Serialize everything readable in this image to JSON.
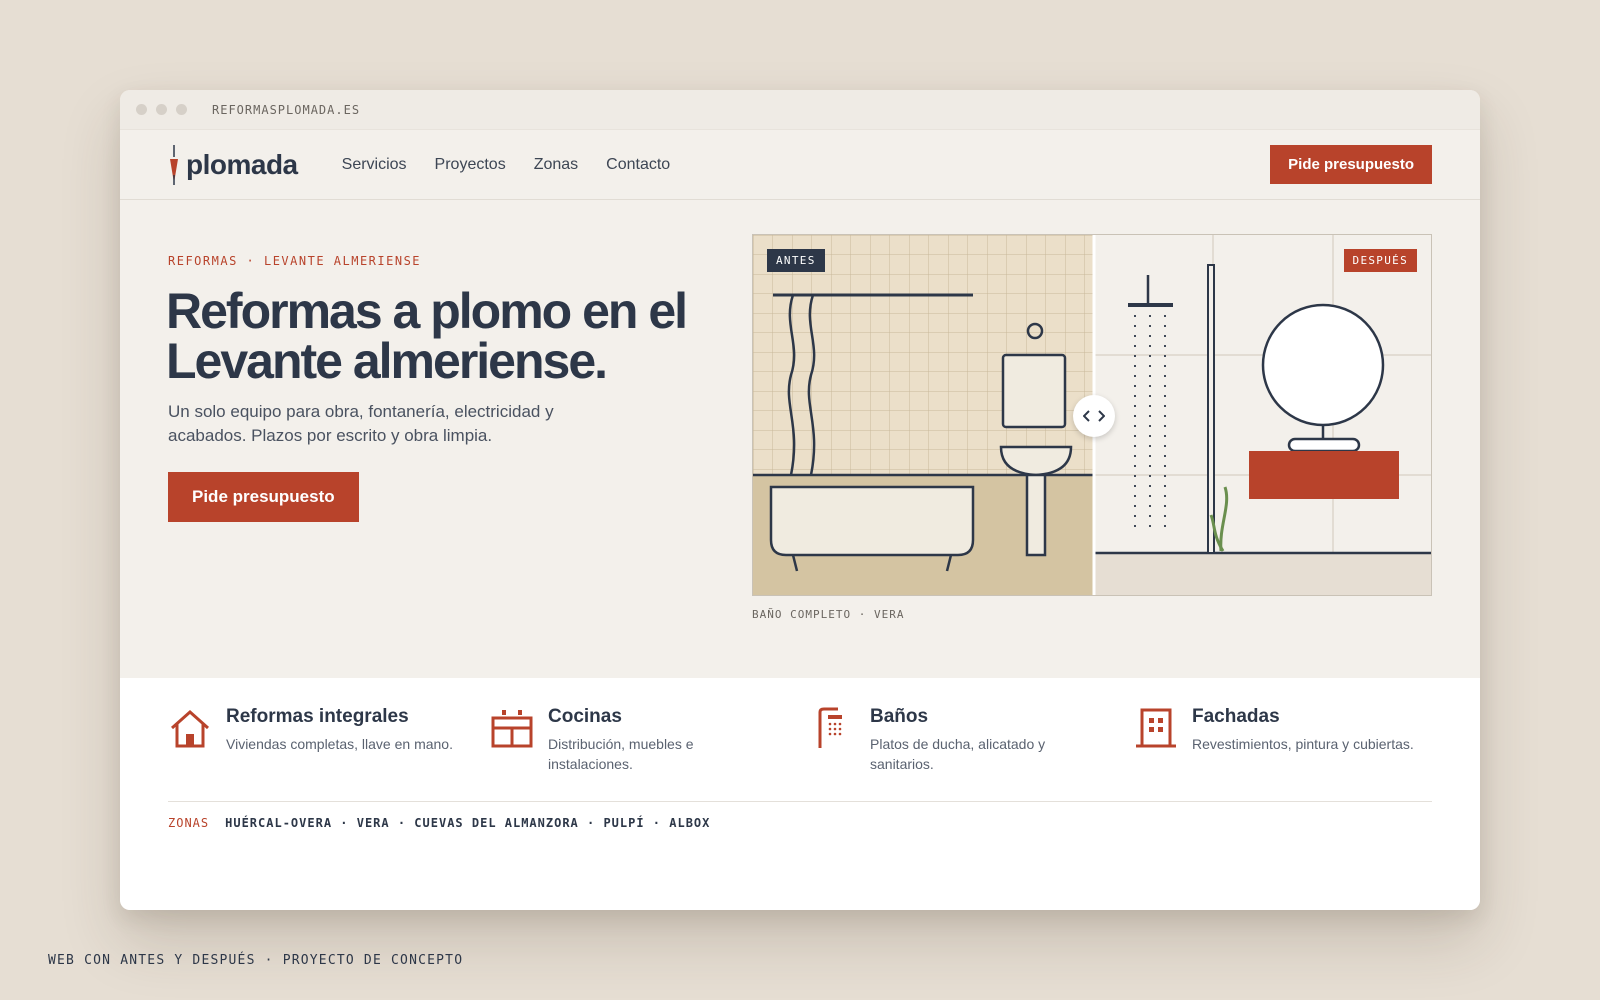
{
  "browser": {
    "url": "REFORMASPLOMADA.ES"
  },
  "nav": {
    "logo": "plomada",
    "links": [
      "Servicios",
      "Proyectos",
      "Zonas",
      "Contacto"
    ],
    "cta": "Pide presupuesto"
  },
  "hero": {
    "eyebrow": "REFORMAS · LEVANTE ALMERIENSE",
    "headline": "Reformas a plomo en el Levante almeriense.",
    "lead": "Un solo equipo para obra, fontanería, electricidad y acabados. Plazos por escrito y obra limpia.",
    "cta": "Pide presupuesto"
  },
  "comparison": {
    "before_label": "ANTES",
    "after_label": "DESPUÉS",
    "caption": "BAÑO COMPLETO · VERA",
    "handle_icon": "chevron-left-right-icon"
  },
  "services": [
    {
      "icon": "house-icon",
      "title": "Reformas integrales",
      "desc": "Viviendas completas, llave en mano."
    },
    {
      "icon": "kitchen-icon",
      "title": "Cocinas",
      "desc": "Distribución, muebles e instalaciones."
    },
    {
      "icon": "shower-icon",
      "title": "Baños",
      "desc": "Platos de ducha, alicatado y sanitarios."
    },
    {
      "icon": "building-icon",
      "title": "Fachadas",
      "desc": "Revestimientos, pintura y cubiertas."
    }
  ],
  "zones": {
    "label": "ZONAS",
    "list": "HUÉRCAL-OVERA · VERA · CUEVAS DEL ALMANZORA · PULPÍ · ALBOX"
  },
  "footer_caption": "WEB CON ANTES Y DESPUÉS · PROYECTO DE CONCEPTO",
  "colors": {
    "accent": "#b8432b",
    "ink": "#2d3748",
    "background": "#e6ded3",
    "surface": "#f3f0eb"
  }
}
